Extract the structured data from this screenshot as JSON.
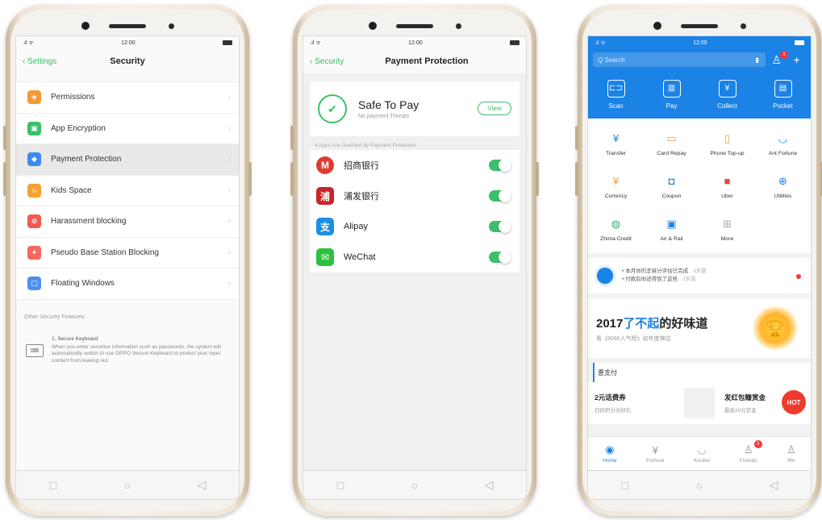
{
  "phone1": {
    "status_time": "12:00",
    "back_label": "Settings",
    "title": "Security",
    "items": [
      {
        "label": "Permissions",
        "color": "#f39a36",
        "icon": "permissions-icon"
      },
      {
        "label": "App Encryption",
        "color": "#3bbf6a",
        "icon": "lock-icon"
      },
      {
        "label": "Payment Protection",
        "color": "#3d8bf0",
        "icon": "shield-icon"
      },
      {
        "label": "Kids Space",
        "color": "#f5a030",
        "icon": "kids-icon"
      },
      {
        "label": "Harassment blocking",
        "color": "#f05a4f",
        "icon": "block-icon"
      },
      {
        "label": "Pseudo Base Station Blocking",
        "color": "#f2675f",
        "icon": "antenna-icon"
      },
      {
        "label": "Floating Windows",
        "color": "#4f8ff0",
        "icon": "window-icon"
      }
    ],
    "other_label": "Other Security Features:",
    "keyboard_title": "1. Secure Keyboard",
    "keyboard_desc": "When you enter sensitive information such as passwords, the system will automatically switch to use OPPO Secure Keyboard to protect your input content from leaking out."
  },
  "phone2": {
    "status_time": "12:00",
    "back_label": "Security",
    "title": "Payment Protection",
    "safe_title": "Safe To Pay",
    "safe_sub": "No payment Threats",
    "view_label": "View",
    "guard_caption": "4 Apps Are Guarded by Payment Protection",
    "apps": [
      {
        "name": "招商银行",
        "color": "#e23a2f",
        "glyph": "M"
      },
      {
        "name": "浦发银行",
        "color": "#c8242b",
        "glyph": "浦"
      },
      {
        "name": "Alipay",
        "color": "#1b8fe6",
        "glyph": "支"
      },
      {
        "name": "WeChat",
        "color": "#2bc13e",
        "glyph": "✉"
      }
    ]
  },
  "phone3": {
    "status_time": "12:00",
    "search_placeholder": "Q Search",
    "badge": "1",
    "quick": [
      {
        "label": "Scan",
        "glyph": "⊏⊐"
      },
      {
        "label": "Pay",
        "glyph": "▥"
      },
      {
        "label": "Collect",
        "glyph": "¥"
      },
      {
        "label": "Pocket",
        "glyph": "▤"
      }
    ],
    "grid": [
      {
        "label": "Transfer",
        "glyph": "¥",
        "color": "#1b82e6"
      },
      {
        "label": "Card Repay",
        "glyph": "▭",
        "color": "#f39a36"
      },
      {
        "label": "Phone Top-up",
        "glyph": "▯",
        "color": "#f39a36"
      },
      {
        "label": "Ant Fortune",
        "glyph": "◡",
        "color": "#1b82e6"
      },
      {
        "label": "Currency",
        "glyph": "¥",
        "color": "#f39a36"
      },
      {
        "label": "Coupon",
        "glyph": "◘",
        "color": "#1b82e6"
      },
      {
        "label": "Uber",
        "glyph": "■",
        "color": "#e8453c"
      },
      {
        "label": "Utilities",
        "glyph": "⊕",
        "color": "#1b82e6"
      },
      {
        "label": "Zhima Credit",
        "glyph": "◍",
        "color": "#2bb673"
      },
      {
        "label": "Air & Rail",
        "glyph": "▣",
        "color": "#1b82e6"
      },
      {
        "label": "More",
        "glyph": "⊞",
        "color": "#aaaaaa"
      }
    ],
    "notice_line1": "• 本月你的芝麻分评估已完成",
    "notice_line1_time": "3天前",
    "notice_line2": "• 付款后你还得到了这些",
    "notice_line2_time": "2天前",
    "banner_year": "2017",
    "banner_highlight": "了不起",
    "banner_rest": "的好味道",
    "banner_sub": "看《8090人气榜》如年度神店",
    "section_label": "惠支付",
    "deal1_title": "2元话费券",
    "deal1_sub": "扫码积分兑好礼",
    "deal2_title": "发红包赚赏金",
    "deal2_sub": "最高10元赏金",
    "hot_label": "HOT",
    "tabs": [
      {
        "label": "Home",
        "glyph": "◉"
      },
      {
        "label": "Fortune",
        "glyph": "¥"
      },
      {
        "label": "Koubei",
        "glyph": "◡"
      },
      {
        "label": "Friends",
        "glyph": "♙"
      },
      {
        "label": "Me",
        "glyph": "♙"
      }
    ],
    "friends_badge": "3"
  }
}
